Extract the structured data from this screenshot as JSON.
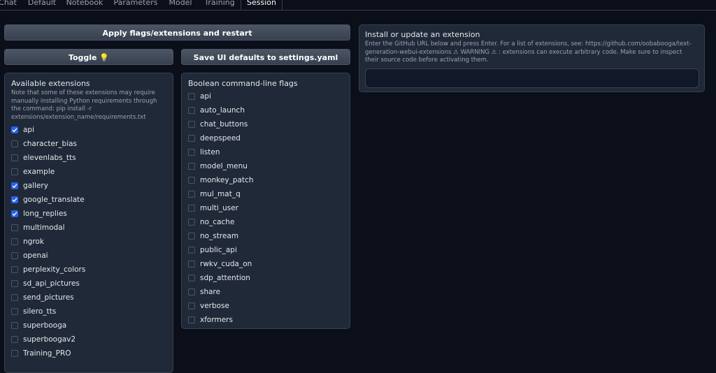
{
  "tabs": [
    {
      "label": "Chat"
    },
    {
      "label": "Default"
    },
    {
      "label": "Notebook"
    },
    {
      "label": "Parameters"
    },
    {
      "label": "Model"
    },
    {
      "label": "Training"
    },
    {
      "label": "Session"
    }
  ],
  "buttons": {
    "apply": "Apply flags/extensions and restart",
    "toggle": "Toggle 💡",
    "save_defaults": "Save UI defaults to settings.yaml"
  },
  "extensions": {
    "title": "Available extensions",
    "info": "Note that some of these extensions may require manually installing Python requirements through the command: pip install -r extensions/extension_name/requirements.txt",
    "items": [
      {
        "label": "api",
        "checked": true
      },
      {
        "label": "character_bias",
        "checked": false
      },
      {
        "label": "elevenlabs_tts",
        "checked": false
      },
      {
        "label": "example",
        "checked": false
      },
      {
        "label": "gallery",
        "checked": true
      },
      {
        "label": "google_translate",
        "checked": true
      },
      {
        "label": "long_replies",
        "checked": true
      },
      {
        "label": "multimodal",
        "checked": false
      },
      {
        "label": "ngrok",
        "checked": false
      },
      {
        "label": "openai",
        "checked": false
      },
      {
        "label": "perplexity_colors",
        "checked": false
      },
      {
        "label": "sd_api_pictures",
        "checked": false
      },
      {
        "label": "send_pictures",
        "checked": false
      },
      {
        "label": "silero_tts",
        "checked": false
      },
      {
        "label": "superbooga",
        "checked": false
      },
      {
        "label": "superboogav2",
        "checked": false
      },
      {
        "label": "Training_PRO",
        "checked": false
      }
    ]
  },
  "flags": {
    "title": "Boolean command-line flags",
    "items": [
      {
        "label": "api",
        "checked": false
      },
      {
        "label": "auto_launch",
        "checked": false
      },
      {
        "label": "chat_buttons",
        "checked": false
      },
      {
        "label": "deepspeed",
        "checked": false
      },
      {
        "label": "listen",
        "checked": false
      },
      {
        "label": "model_menu",
        "checked": false
      },
      {
        "label": "monkey_patch",
        "checked": false
      },
      {
        "label": "mul_mat_q",
        "checked": false
      },
      {
        "label": "multi_user",
        "checked": false
      },
      {
        "label": "no_cache",
        "checked": false
      },
      {
        "label": "no_stream",
        "checked": false
      },
      {
        "label": "public_api",
        "checked": false
      },
      {
        "label": "rwkv_cuda_on",
        "checked": false
      },
      {
        "label": "sdp_attention",
        "checked": false
      },
      {
        "label": "share",
        "checked": false
      },
      {
        "label": "verbose",
        "checked": false
      },
      {
        "label": "xformers",
        "checked": false
      }
    ]
  },
  "install": {
    "title": "Install or update an extension",
    "info": "Enter the GitHub URL below and press Enter. For a list of extensions, see: https://github.com/oobabooga/text-generation-webui-extensions ⚠ WARNING ⚠ : extensions can execute arbitrary code. Make sure to inspect their source code before activating them.",
    "value": ""
  },
  "colors": {
    "background": "#0b0f19",
    "panel": "#1f2937",
    "accent": "#2563eb"
  }
}
